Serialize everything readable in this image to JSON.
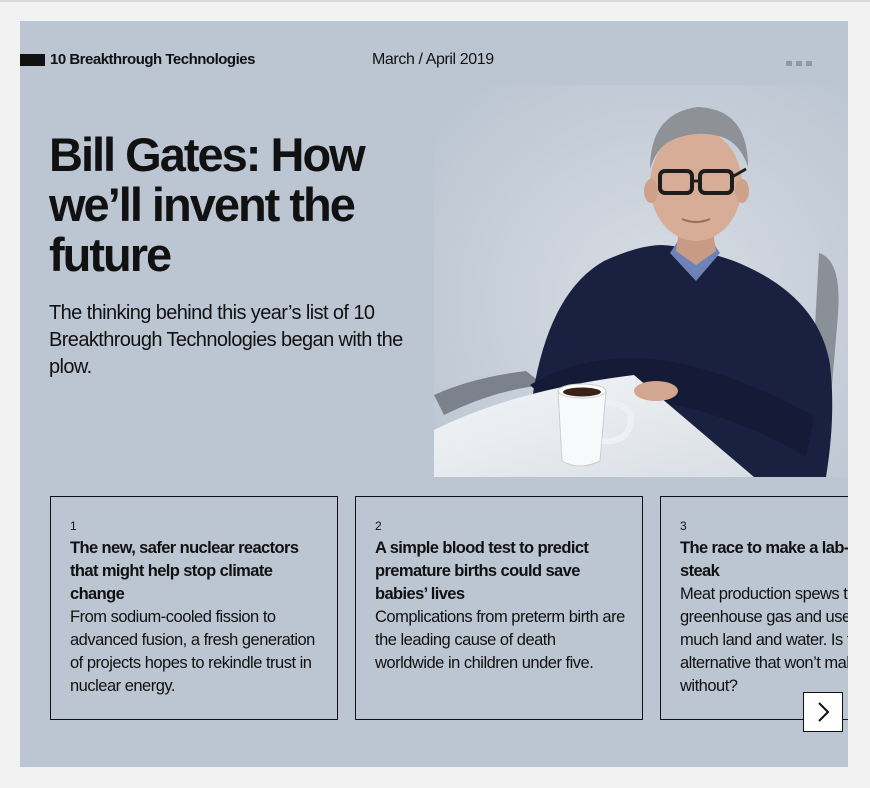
{
  "header": {
    "section_label": "10 Breakthrough Technologies",
    "issue_date": "March / April 2019",
    "more_icon": "more-dots-icon"
  },
  "article": {
    "headline": "Bill Gates: How we’ll invent the future",
    "dek": "The thinking behind this year’s list of 10 Breakthrough Technologies began with the plow."
  },
  "cards": [
    {
      "number": "1",
      "title": "The new, safer nuclear reactors that might help stop climate change",
      "description": "From sodium-cooled fission to advanced fusion, a fresh generation of projects hopes to rekindle trust in nuclear energy."
    },
    {
      "number": "2",
      "title": "A simple blood test to predict premature births could save babies’ lives",
      "description": "Complications from preterm birth are the leading cause of death worldwide in children under five."
    },
    {
      "number": "3",
      "title": "The race to make a lab-grown steak",
      "description": "Meat production spews tons of greenhouse gas and uses up too much land and water. Is there an alternative that won’t make us do without?"
    }
  ],
  "carousel": {
    "next_icon": "chevron-right-icon"
  },
  "colors": {
    "panel_bg": "#bcc6d2",
    "text": "#111111",
    "border": "#111111"
  }
}
